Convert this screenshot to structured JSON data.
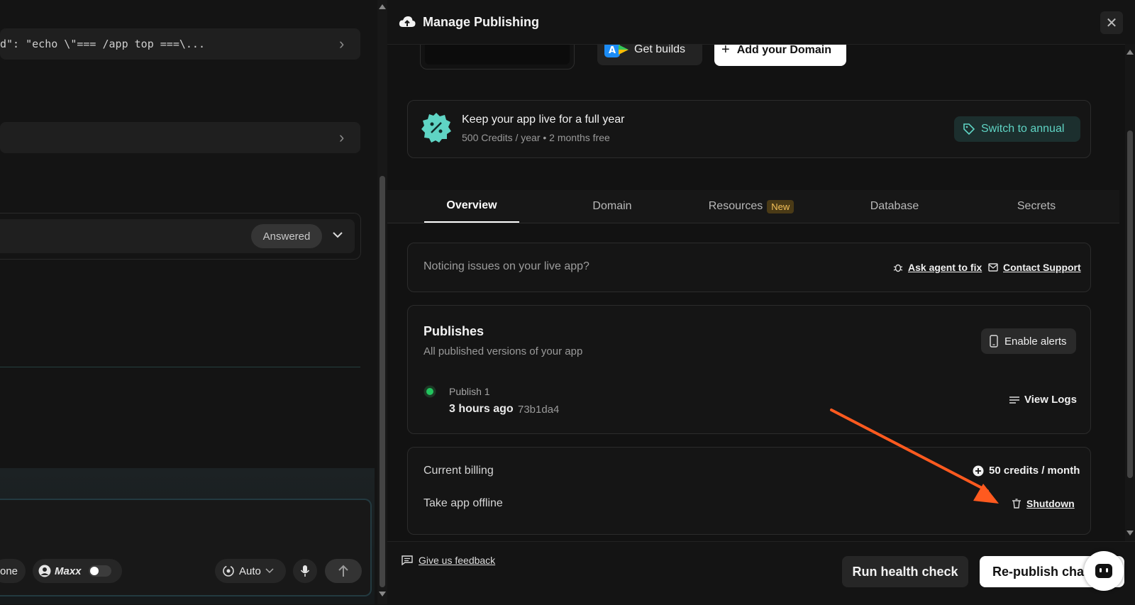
{
  "left": {
    "tool_call_1": "d\": \"echo \\\"=== /app top ===\\...",
    "answered_badge": "Answered",
    "composer": {
      "done_label": "one",
      "maxx_label": "Maxx",
      "mode_label": "Auto"
    }
  },
  "panel": {
    "title": "Manage Publishing",
    "get_builds": "Get builds",
    "add_domain": "Add your Domain",
    "promo": {
      "title": "Keep your app live for a full year",
      "subtitle": "500 Credits / year • 2 months free",
      "button": "Switch to annual"
    },
    "tabs": [
      {
        "label": "Overview"
      },
      {
        "label": "Domain"
      },
      {
        "label": "Resources",
        "badge": "New"
      },
      {
        "label": "Database"
      },
      {
        "label": "Secrets"
      }
    ],
    "issues": {
      "text": "Noticing issues on your live app?",
      "ask_agent": "Ask agent to fix",
      "contact_support": "Contact Support"
    },
    "publishes": {
      "title": "Publishes",
      "subtitle": "All published versions of your app",
      "enable_alerts": "Enable alerts",
      "item": {
        "name": "Publish 1",
        "time": "3 hours ago",
        "hash": "73b1da4"
      },
      "view_logs": "View Logs"
    },
    "billing": {
      "label": "Current billing",
      "value": "50 credits / month",
      "offline_label": "Take app offline",
      "shutdown": "Shutdown"
    },
    "footer": {
      "feedback": "Give us feedback",
      "health_check": "Run health check",
      "republish": "Re-publish changes"
    }
  },
  "colors": {
    "accent_teal": "#5fd4c4",
    "status_green": "#22c55e",
    "arrow_orange": "#ff5a1f",
    "badge_new_bg": "#4a3a16",
    "badge_new_fg": "#f5c15a"
  }
}
